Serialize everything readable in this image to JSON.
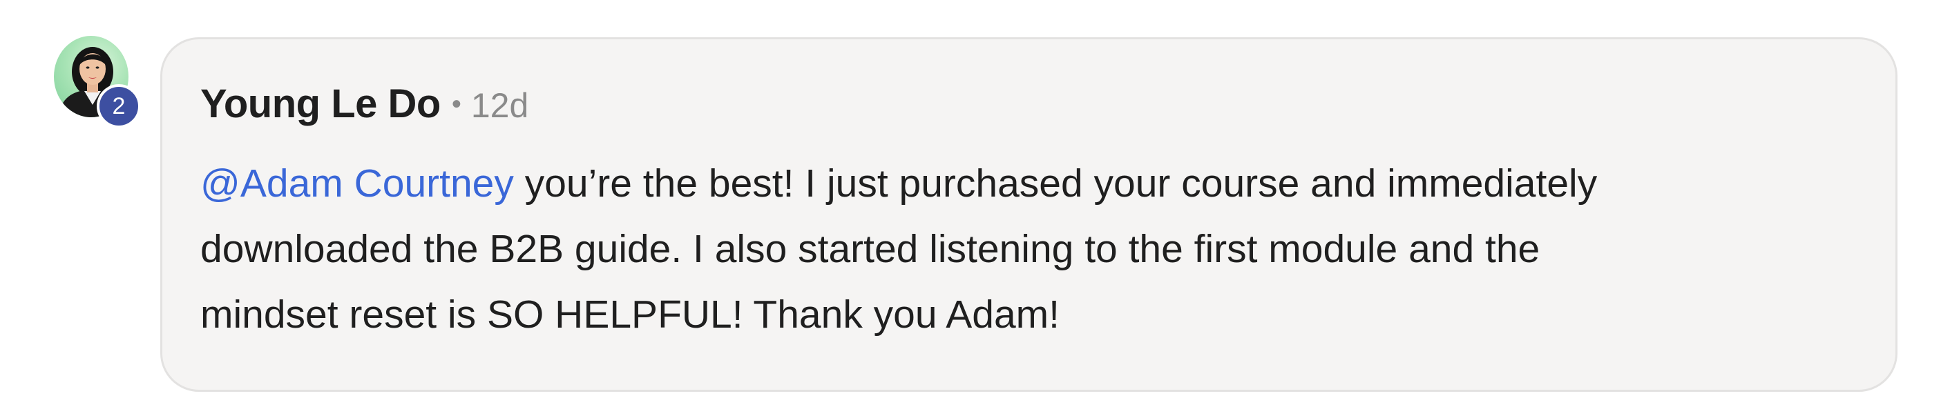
{
  "comment": {
    "author": {
      "name": "Young Le Do",
      "level": "2"
    },
    "separator": "•",
    "timestamp": "12d",
    "mention": "@Adam Courtney",
    "line1_rest": " you’re the best! I just purchased your course and immediately",
    "line2": "downloaded the B2B guide. I also started listening to the first module and the",
    "line3": "mindset reset is SO HELPFUL! Thank you Adam!"
  },
  "colors": {
    "mention": "#3a67d8",
    "badge": "#3d4fa1",
    "card_background": "#f5f4f3",
    "card_border": "#e3e2e1"
  }
}
